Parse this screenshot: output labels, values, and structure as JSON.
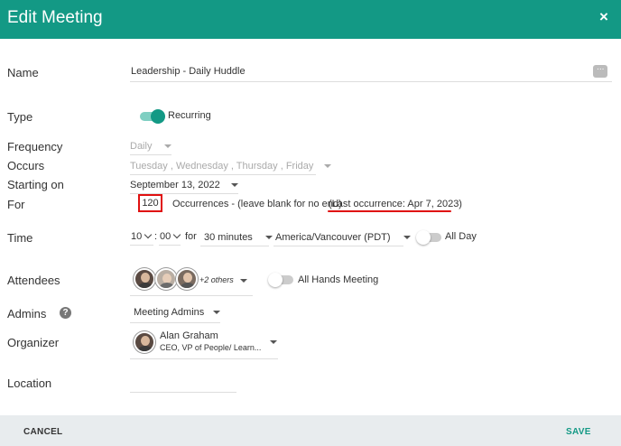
{
  "header": {
    "title": "Edit Meeting",
    "close_glyph": "×"
  },
  "fields": {
    "name": {
      "label": "Name",
      "value": "Leadership - Daily Huddle",
      "more_glyph": "···"
    },
    "type": {
      "label": "Type",
      "toggle_label": "Recurring",
      "toggle_on": true
    },
    "frequency": {
      "label": "Frequency",
      "value": "Daily"
    },
    "occurs": {
      "label": "Occurs",
      "value": "Tuesday , Wednesday , Thursday , Friday"
    },
    "starting_on": {
      "label": "Starting on",
      "value": "September 13, 2022"
    },
    "for": {
      "label": "For",
      "count": "120",
      "suffix": "Occurrences - (leave blank for no end)",
      "last_occurrence": "(Last occurrence: Apr 7, 2023)"
    },
    "time": {
      "label": "Time",
      "hour": "10",
      "minute": "00",
      "for_word": "for",
      "duration": "30 minutes",
      "timezone": "America/Vancouver (PDT)",
      "all_day_label": "All Day",
      "all_day_on": false
    },
    "attendees": {
      "label": "Attendees",
      "others": "+2 others",
      "all_hands_label": "All Hands Meeting",
      "all_hands_on": false
    },
    "admins": {
      "label": "Admins",
      "help_glyph": "?",
      "value": "Meeting Admins"
    },
    "organizer": {
      "label": "Organizer",
      "name": "Alan Graham",
      "role": "CEO, VP of People/ Learn..."
    },
    "location": {
      "label": "Location",
      "value": ""
    }
  },
  "footer": {
    "cancel_label": "CANCEL",
    "save_label": "SAVE"
  },
  "colors": {
    "primary": "#139985",
    "highlight": "#e01010",
    "footer_bg": "#e8ecee"
  },
  "icons": [
    "close-icon",
    "more-icon",
    "help-icon",
    "caret-down-icon"
  ]
}
